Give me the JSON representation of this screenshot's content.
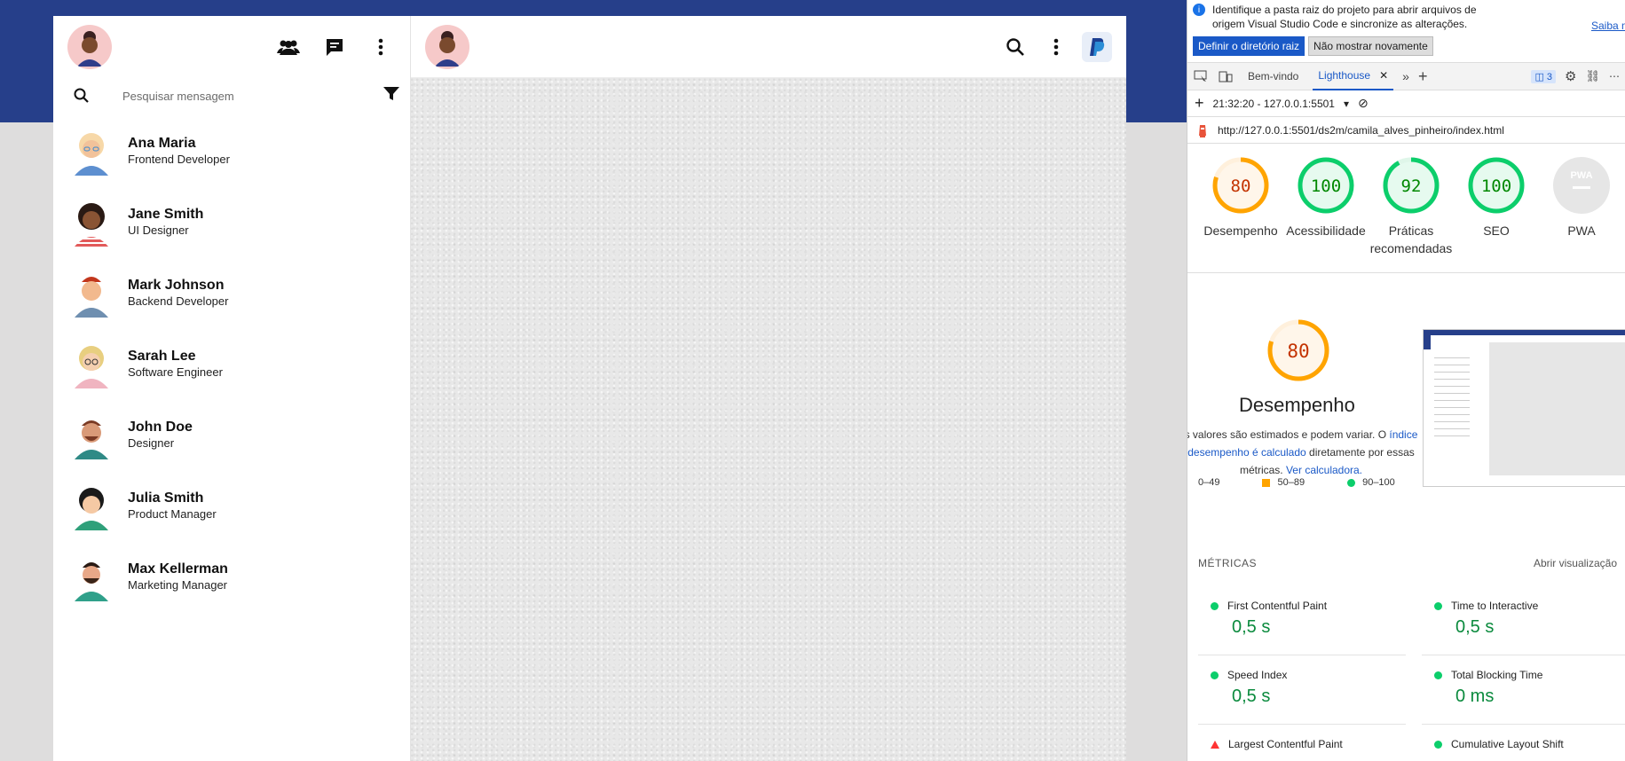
{
  "app": {
    "search_placeholder": "Pesquisar mensagem",
    "contacts": [
      {
        "name": "Ana Maria",
        "role": "Frontend Developer"
      },
      {
        "name": "Jane Smith",
        "role": "UI Designer"
      },
      {
        "name": "Mark Johnson",
        "role": "Backend Developer"
      },
      {
        "name": "Sarah Lee",
        "role": "Software Engineer"
      },
      {
        "name": "John Doe",
        "role": "Designer"
      },
      {
        "name": "Julia Smith",
        "role": "Product Manager"
      },
      {
        "name": "Max Kellerman",
        "role": "Marketing Manager"
      }
    ],
    "colors": {
      "topbar": "#263f8a",
      "bg": "#dedddd"
    }
  },
  "devtools": {
    "info_text": "Identifique a pasta raiz do projeto para abrir arquivos de origem Visual Studio Code e sincronize as alterações.",
    "info_link": "Saiba m",
    "btn_set_root": "Definir o diretório raiz",
    "btn_dont_show": "Não mostrar novamente",
    "tabs": [
      "Bem-vindo",
      "Lighthouse"
    ],
    "issues_count": "3",
    "run_label": "21:32:20 - 127.0.0.1:5501",
    "url": "http://127.0.0.1:5501/ds2m/camila_alves_pinheiro/index.html",
    "gauges": [
      {
        "score": "80",
        "label": "Desempenho",
        "color": "#ffa400"
      },
      {
        "score": "100",
        "label": "Acessibilidade",
        "color": "#0cce6b"
      },
      {
        "score": "92",
        "label": "Práticas recomendadas",
        "color": "#0cce6b"
      },
      {
        "score": "100",
        "label": "SEO",
        "color": "#0cce6b"
      },
      {
        "score": "PWA",
        "label": "PWA",
        "color": "#b3b3b3"
      }
    ],
    "perf_score": "80",
    "perf_title": "Desempenho",
    "perf_desc_1": "s valores são estimados e podem variar. O ",
    "perf_desc_link": "índice",
    "perf_desc_link2": " desempenho é calculado",
    "perf_desc_2": " diretamente por essas métricas. ",
    "perf_calc": "Ver calculadora.",
    "legend": [
      "0–49",
      "50–89",
      "90–100"
    ],
    "metrics_title": "MÉTRICAS",
    "metrics_open": "Abrir visualização",
    "metrics": [
      {
        "name": "First Contentful Paint",
        "value": "0,5 s"
      },
      {
        "name": "Time to Interactive",
        "value": "0,5 s"
      },
      {
        "name": "Speed Index",
        "value": "0,5 s"
      },
      {
        "name": "Total Blocking Time",
        "value": "0 ms"
      },
      {
        "name": "Largest Contentful Paint",
        "value": ""
      },
      {
        "name": "Cumulative Layout Shift",
        "value": ""
      }
    ]
  }
}
